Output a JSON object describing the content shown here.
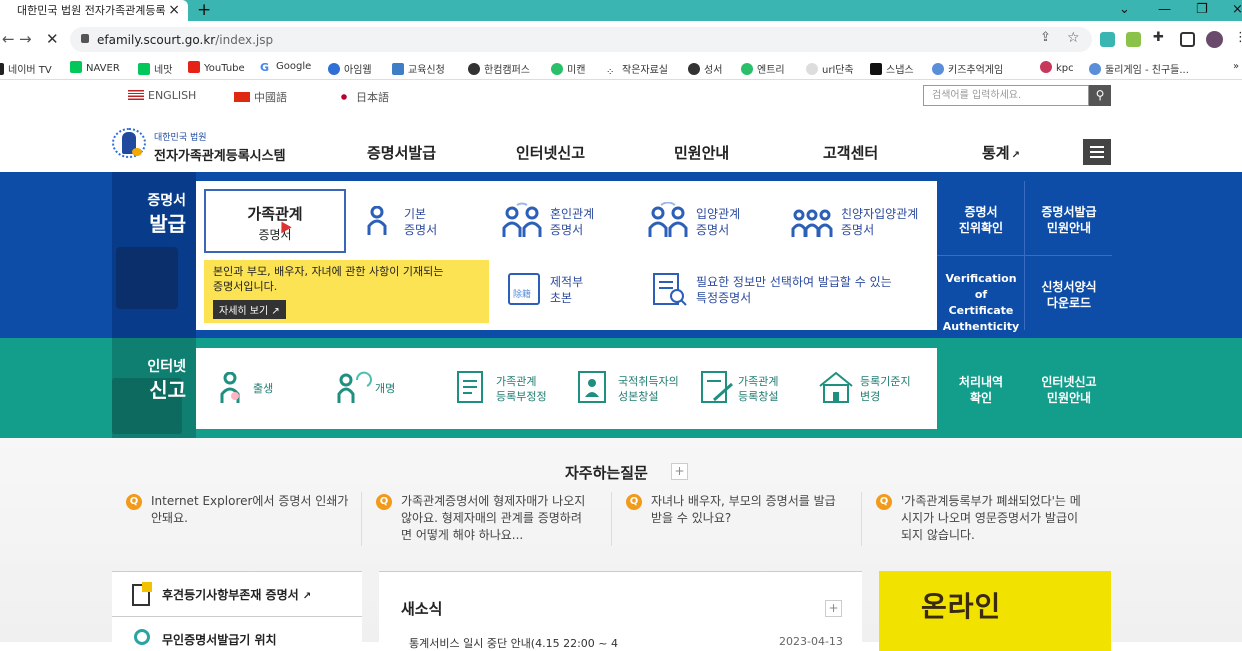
{
  "browser": {
    "tab_title": "대한민국 법원 전자가족관계등록",
    "url_host": "efamily.scourt.go.kr",
    "url_path": "/index.jsp",
    "bookmarks": [
      "네이버 TV",
      "NAVER",
      "네맛",
      "YouTube",
      "Google",
      "아임웹",
      "교육신청",
      "한컴캠퍼스",
      "미캔",
      "작은자료실",
      "성서",
      "엔트리",
      "url단축",
      "스냅스",
      "키즈추억게임",
      "kpc",
      "둘리게임 - 친구들..."
    ]
  },
  "lang": [
    "ENGLISH",
    "中國語",
    "日本語"
  ],
  "search_placeholder": "검색어를 입력하세요.",
  "logo": {
    "line1": "대한민국 법원",
    "line2": "전자가족관계등록시스템"
  },
  "gnav": [
    "증명서발급",
    "인터넷신고",
    "민원안내",
    "고객센터",
    "통계"
  ],
  "cert": {
    "title1": "증명서",
    "title2": "발급",
    "selected": {
      "l1": "가족관계",
      "l2": "증명서"
    },
    "items": [
      {
        "l1": "기본",
        "l2": "증명서"
      },
      {
        "l1": "혼인관계",
        "l2": "증명서"
      },
      {
        "l1": "입양관계",
        "l2": "증명서"
      },
      {
        "l1": "친양자입양관계",
        "l2": "증명서"
      }
    ],
    "tip": "본인과 부모, 배우자, 자녀에 관한 사항이 기재되는 증명서입니다.",
    "tip_l1": "본인과 부모, 배우자, 자녀에 관한 사항이 기재되는",
    "tip_l2": "증명서입니다.",
    "tip_btn": "자세히 보기",
    "removed": {
      "l1": "제적부",
      "l2": "초본"
    },
    "special": {
      "l1": "필요한 정보만 선택하여 발급할 수 있는",
      "l2": "특정증명서"
    },
    "side": [
      {
        "l1": "증명서",
        "l2": "진위확인"
      },
      {
        "l1": "증명서발급",
        "l2": "민원안내"
      },
      {
        "l1": "Verification of",
        "l2": "Certificate",
        "l3": "Authenticity"
      },
      {
        "l1": "신청서양식",
        "l2": "다운로드"
      }
    ]
  },
  "report": {
    "title1": "인터넷",
    "title2": "신고",
    "items": [
      {
        "l1": "출생",
        "l2": ""
      },
      {
        "l1": "개명",
        "l2": ""
      },
      {
        "l1": "가족관계",
        "l2": "등록부정정"
      },
      {
        "l1": "국적취득자의",
        "l2": "성본창설"
      },
      {
        "l1": "가족관계",
        "l2": "등록창설"
      },
      {
        "l1": "등록기준지",
        "l2": "변경"
      }
    ],
    "side": [
      {
        "l1": "처리내역",
        "l2": "확인"
      },
      {
        "l1": "인터넷신고",
        "l2": "민원안내"
      }
    ]
  },
  "faq": {
    "title": "자주하는질문",
    "items": [
      {
        "l1": "Internet Explorer에서 증명서 인쇄가",
        "l2": "안돼요.",
        "l3": ""
      },
      {
        "l1": "가족관계증명서에 형제자매가 나오지",
        "l2": "않아요. 형제자매의 관계를 증명하려",
        "l3": "면 어떻게 해야 하나요..."
      },
      {
        "l1": "자녀나 배우자, 부모의 증명서를 발급",
        "l2": "받을 수 있나요?",
        "l3": ""
      },
      {
        "l1": "'가족관계등록부가 폐쇄되었다'는 메",
        "l2": "시지가 나오며 영문증명서가 발급이",
        "l3": "되지 않습니다."
      }
    ]
  },
  "bottom": {
    "left1": "후견등기사항부존재 증명서",
    "left2": "무인증명서발급기 위치",
    "news_title": "새소식",
    "news_item": "통계서비스 일시 중단 안내(4.15 22:00 ~ 4",
    "news_date": "2023-04-13",
    "banner": "온라인"
  },
  "colors": {
    "blue": "#0d4da8",
    "teal": "#139d8b",
    "yellow": "#fbe354"
  }
}
